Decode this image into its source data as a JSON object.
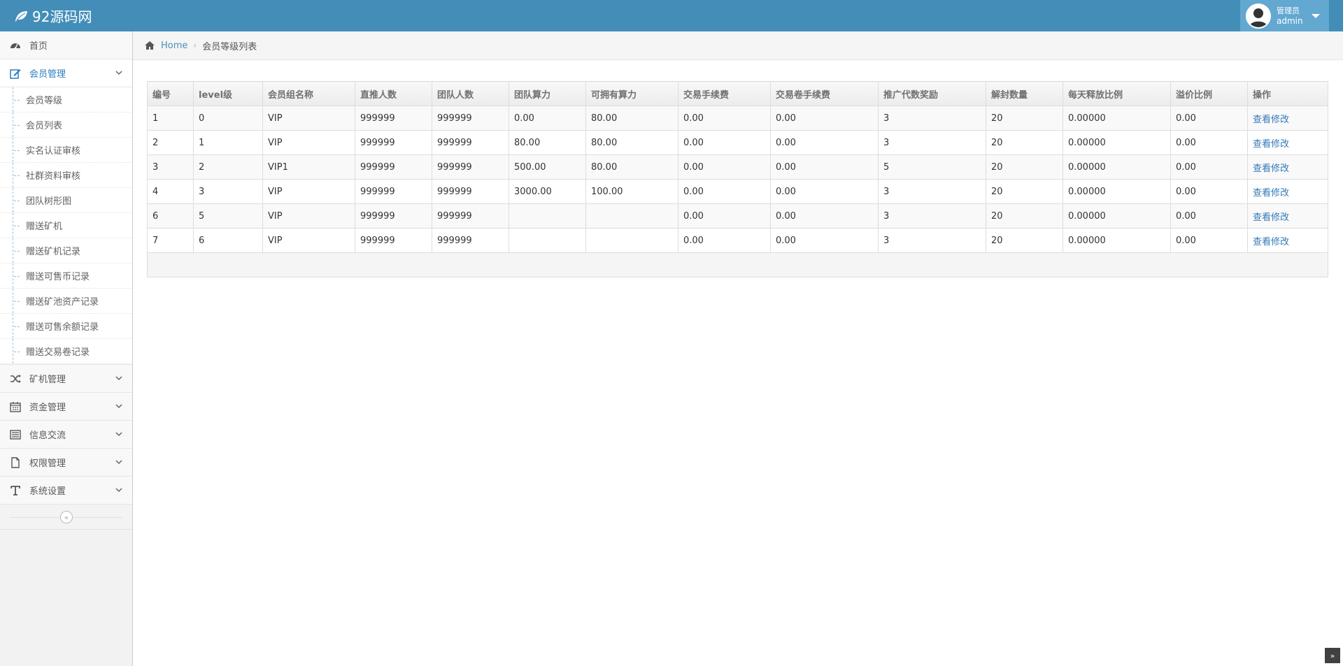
{
  "navbar": {
    "brand": "92源码网",
    "user_role": "管理员",
    "user_name": "admin"
  },
  "sidebar": {
    "items": [
      {
        "label": "首页",
        "icon": "dashboard-icon"
      },
      {
        "label": "会员管理",
        "icon": "edit-icon"
      },
      {
        "label": "矿机管理",
        "icon": "shuffle-icon"
      },
      {
        "label": "资金管理",
        "icon": "calendar-icon"
      },
      {
        "label": "信息交流",
        "icon": "list-icon"
      },
      {
        "label": "权限管理",
        "icon": "file-icon"
      },
      {
        "label": "系统设置",
        "icon": "text-icon"
      }
    ],
    "submenu": [
      "会员等级",
      "会员列表",
      "实名认证审核",
      "社群资料审核",
      "团队树形图",
      "赠送矿机",
      "赠送矿机记录",
      "赠送可售币记录",
      "赠送矿池资产记录",
      "赠送可售余额记录",
      "赠送交易卷记录"
    ]
  },
  "breadcrumb": {
    "home": "Home",
    "current": "会员等级列表"
  },
  "table": {
    "headers": [
      "编号",
      "level级",
      "会员组名称",
      "直推人数",
      "团队人数",
      "团队算力",
      "可拥有算力",
      "交易手续费",
      "交易卷手续费",
      "推广代数奖励",
      "解封数量",
      "每天释放比例",
      "溢价比例",
      "操作"
    ],
    "rows": [
      [
        "1",
        "0",
        "VIP",
        "999999",
        "999999",
        "0.00",
        "80.00",
        "0.00",
        "0.00",
        "3",
        "20",
        "0.00000",
        "0.00",
        "查看修改"
      ],
      [
        "2",
        "1",
        "VIP",
        "999999",
        "999999",
        "80.00",
        "80.00",
        "0.00",
        "0.00",
        "3",
        "20",
        "0.00000",
        "0.00",
        "查看修改"
      ],
      [
        "3",
        "2",
        "VIP1",
        "999999",
        "999999",
        "500.00",
        "80.00",
        "0.00",
        "0.00",
        "5",
        "20",
        "0.00000",
        "0.00",
        "查看修改"
      ],
      [
        "4",
        "3",
        "VIP",
        "999999",
        "999999",
        "3000.00",
        "100.00",
        "0.00",
        "0.00",
        "3",
        "20",
        "0.00000",
        "0.00",
        "查看修改"
      ],
      [
        "6",
        "5",
        "VIP",
        "999999",
        "999999",
        "",
        "",
        "0.00",
        "0.00",
        "3",
        "20",
        "0.00000",
        "0.00",
        "查看修改"
      ],
      [
        "7",
        "6",
        "VIP",
        "999999",
        "999999",
        "",
        "",
        "0.00",
        "0.00",
        "3",
        "20",
        "0.00000",
        "0.00",
        "查看修改"
      ]
    ]
  },
  "colors": {
    "navbar": "#438eb9",
    "user_box": "#62a8d1",
    "link": "#337ab7",
    "active_menu": "#2b7dbc"
  }
}
